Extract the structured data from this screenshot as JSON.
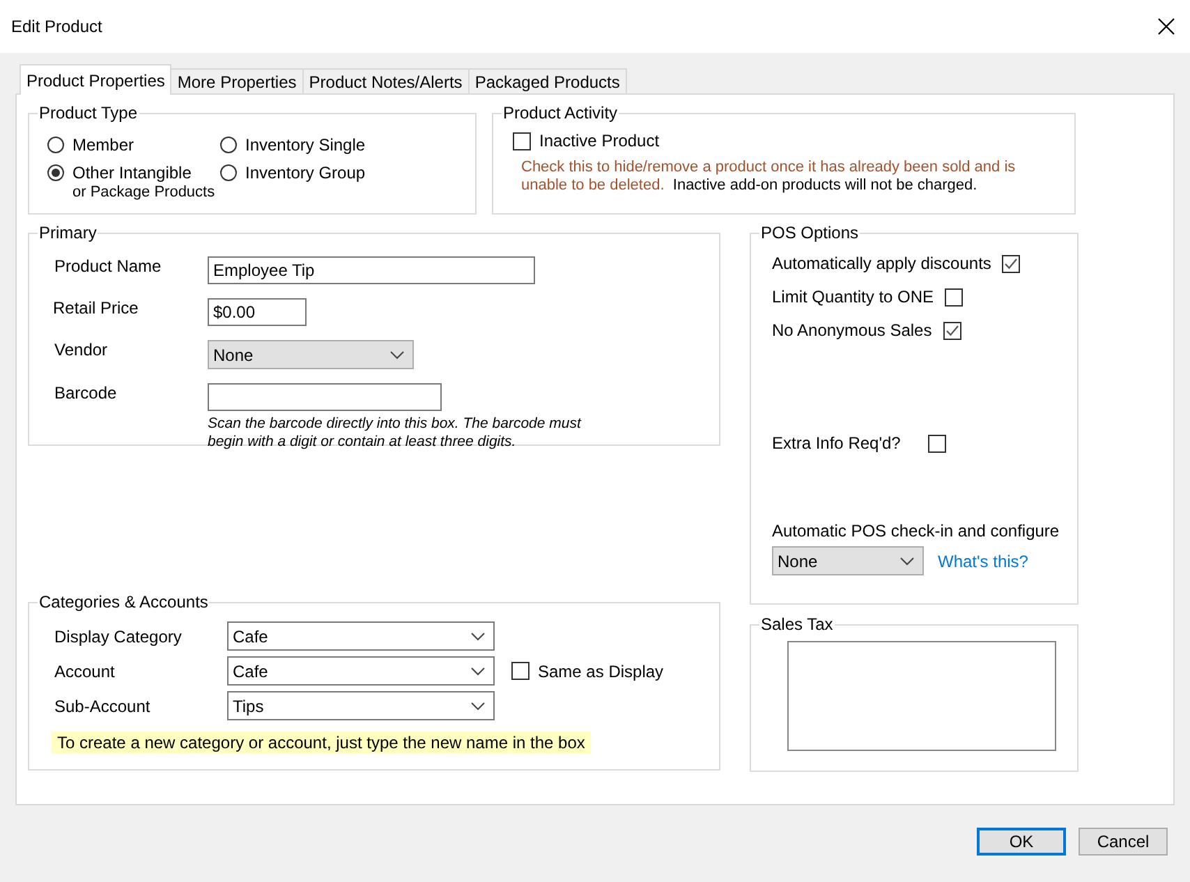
{
  "window": {
    "title": "Edit Product"
  },
  "tabs": [
    {
      "label": "Product Properties",
      "selected": true
    },
    {
      "label": "More Properties",
      "selected": false
    },
    {
      "label": "Product Notes/Alerts",
      "selected": false
    },
    {
      "label": "Packaged Products",
      "selected": false
    }
  ],
  "product_type": {
    "title": "Product Type",
    "options": [
      {
        "label": "Member",
        "selected": false
      },
      {
        "label": "Inventory Single",
        "selected": false
      },
      {
        "label": "Other Intangible",
        "sublabel": "or Package Products",
        "selected": true
      },
      {
        "label": "Inventory Group",
        "selected": false
      }
    ]
  },
  "product_activity": {
    "title": "Product Activity",
    "checkbox": {
      "label": "Inactive Product",
      "checked": false
    },
    "warning": "Check this to hide/remove a product once it has already been sold and is unable to be deleted.",
    "note": "Inactive add-on products will not be charged."
  },
  "primary": {
    "title": "Primary",
    "fields": [
      {
        "kind": "text",
        "label": "Product Name",
        "value": "Employee Tip"
      },
      {
        "kind": "text",
        "label": "Retail Price",
        "value": "$0.00"
      },
      {
        "kind": "dropdown",
        "label": "Vendor",
        "value": "None"
      },
      {
        "kind": "text",
        "label": "Barcode",
        "hint": "Scan the barcode directly into this box.  The barcode must begin with a digit or contain at least three digits."
      }
    ]
  },
  "pos_options": {
    "title": "POS Options",
    "checkboxes": [
      {
        "label": "Automatically apply discounts",
        "checked": true
      },
      {
        "label": "Limit Quantity to ONE",
        "checked": false
      },
      {
        "label": "No Anonymous Sales",
        "checked": true
      },
      {
        "label": "Extra Info Req'd?",
        "checked": false
      }
    ],
    "auto_checkin": {
      "label": "Automatic POS check-in and configure",
      "value": "None",
      "link": "What's this?"
    }
  },
  "categories": {
    "title": "Categories & Accounts",
    "rows": [
      {
        "label": "Display Category",
        "value": "Cafe"
      },
      {
        "label": "Account",
        "value": "Cafe",
        "checkbox": {
          "label": "Same as Display",
          "checked": false
        }
      },
      {
        "label": "Sub-Account",
        "value": "Tips"
      }
    ],
    "note": "To create a new category or account, just type the new name in the box"
  },
  "sales_tax": {
    "title": "Sales Tax"
  },
  "buttons": [
    {
      "label": "OK",
      "default": true
    },
    {
      "label": "Cancel",
      "default": false
    }
  ]
}
